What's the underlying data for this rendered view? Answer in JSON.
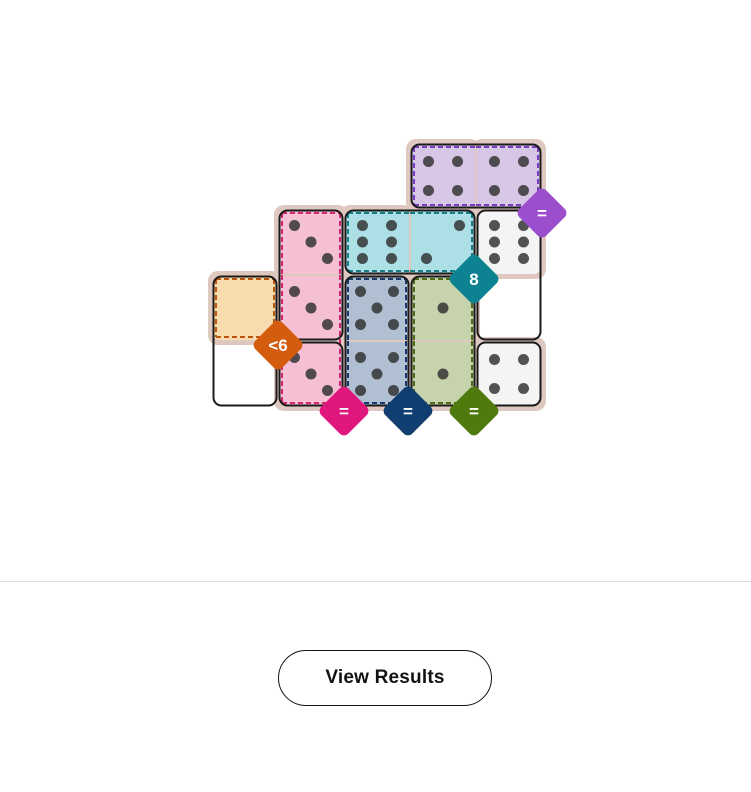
{
  "puzzle": {
    "rows": 4,
    "cols": 5,
    "cells": [
      {
        "row": 0,
        "col": 3,
        "pips": 4,
        "region": "purple"
      },
      {
        "row": 0,
        "col": 4,
        "pips": 4,
        "region": "purple"
      },
      {
        "row": 1,
        "col": 1,
        "pips": 3,
        "region": "pink"
      },
      {
        "row": 1,
        "col": 2,
        "pips": 6,
        "region": "teal"
      },
      {
        "row": 1,
        "col": 3,
        "pips": 2,
        "region": "teal"
      },
      {
        "row": 1,
        "col": 4,
        "pips": 6,
        "region": null
      },
      {
        "row": 2,
        "col": 0,
        "pips": 0,
        "region": "orange"
      },
      {
        "row": 2,
        "col": 1,
        "pips": 3,
        "region": "pink"
      },
      {
        "row": 2,
        "col": 2,
        "pips": 5,
        "region": "navy"
      },
      {
        "row": 2,
        "col": 3,
        "pips": 1,
        "region": "green"
      },
      {
        "row": 3,
        "col": 1,
        "pips": 3,
        "region": "pink"
      },
      {
        "row": 3,
        "col": 2,
        "pips": 5,
        "region": "navy"
      },
      {
        "row": 3,
        "col": 3,
        "pips": 1,
        "region": "green"
      },
      {
        "row": 3,
        "col": 4,
        "pips": 4,
        "region": null
      }
    ],
    "dominoes": [
      [
        [
          0,
          3
        ],
        [
          0,
          4
        ]
      ],
      [
        [
          1,
          1
        ],
        [
          2,
          1
        ]
      ],
      [
        [
          1,
          2
        ],
        [
          1,
          3
        ]
      ],
      [
        [
          1,
          4
        ],
        [
          2,
          4
        ]
      ],
      [
        [
          2,
          0
        ],
        [
          3,
          0
        ]
      ],
      [
        [
          2,
          2
        ],
        [
          3,
          2
        ]
      ],
      [
        [
          2,
          3
        ],
        [
          3,
          3
        ]
      ],
      [
        [
          3,
          1
        ],
        [
          3,
          1
        ]
      ],
      [
        [
          3,
          4
        ],
        [
          3,
          4
        ]
      ]
    ],
    "regions": {
      "purple": {
        "fill": "#d8c6e6",
        "border": "#7a3dbf",
        "badge_color": "#9b4fcc",
        "label": "="
      },
      "pink": {
        "fill": "#f5bfd4",
        "border": "#d0276f",
        "badge_color": "#e0177c",
        "label": "="
      },
      "teal": {
        "fill": "#ade0e6",
        "border": "#137e88",
        "badge_color": "#0d8290",
        "label": "8"
      },
      "orange": {
        "fill": "#f9dbb0",
        "border": "#b8560a",
        "badge_color": "#d45c0f",
        "label": "<6"
      },
      "navy": {
        "fill": "#b1bfd2",
        "border": "#17386b",
        "badge_color": "#103e70",
        "label": "="
      },
      "green": {
        "fill": "#c7d3ac",
        "border": "#4d6a14",
        "badge_color": "#4f7a0e",
        "label": "="
      }
    },
    "colors": {
      "board_background": "#dfc8bf",
      "empty_cell": "#f4f4f4",
      "domino_border": "#1a1a1a",
      "pip": "#2e2e2e"
    }
  },
  "actions": {
    "view_results_label": "View Results"
  }
}
